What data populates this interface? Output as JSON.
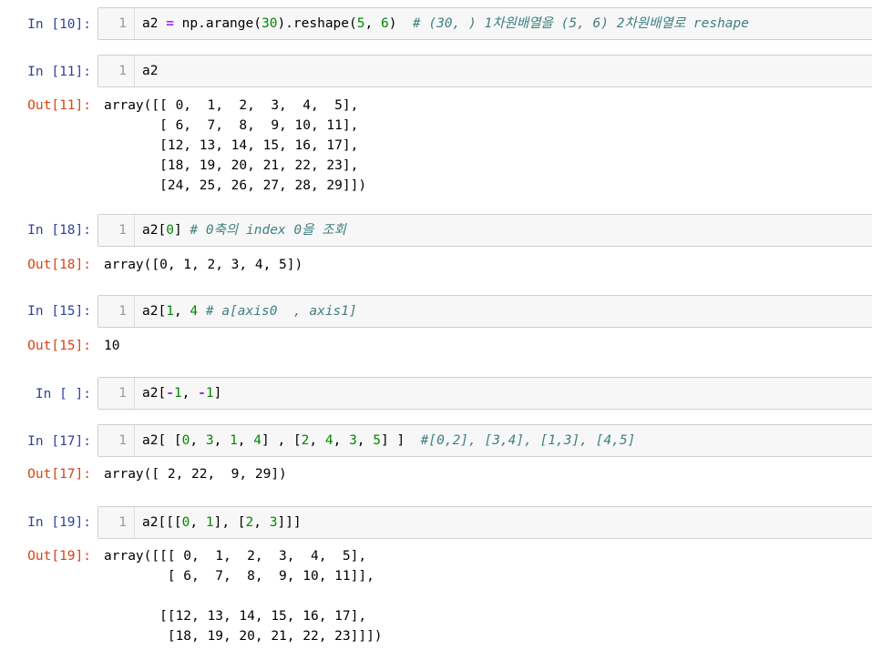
{
  "cells": [
    {
      "id": "c10",
      "prompt": "In [10]:",
      "line": "1",
      "tokens": [
        {
          "t": "a2 ",
          "k": "plain"
        },
        {
          "t": "=",
          "k": "op"
        },
        {
          "t": " np.arange(",
          "k": "plain"
        },
        {
          "t": "30",
          "k": "num"
        },
        {
          "t": ").reshape(",
          "k": "plain"
        },
        {
          "t": "5",
          "k": "num"
        },
        {
          "t": ", ",
          "k": "plain"
        },
        {
          "t": "6",
          "k": "num"
        },
        {
          "t": ")  ",
          "k": "plain"
        },
        {
          "t": "# (30, ) 1차원배열을 (5, 6) 2차원배열로 reshape",
          "k": "cmt"
        }
      ]
    },
    {
      "id": "c11",
      "prompt": "In [11]:",
      "line": "1",
      "tokens": [
        {
          "t": "a2",
          "k": "plain"
        }
      ],
      "out_prompt": "Out[11]:",
      "output": "array([[ 0,  1,  2,  3,  4,  5],\n       [ 6,  7,  8,  9, 10, 11],\n       [12, 13, 14, 15, 16, 17],\n       [18, 19, 20, 21, 22, 23],\n       [24, 25, 26, 27, 28, 29]])"
    },
    {
      "id": "c18",
      "prompt": "In [18]:",
      "line": "1",
      "tokens": [
        {
          "t": "a2[",
          "k": "plain"
        },
        {
          "t": "0",
          "k": "num"
        },
        {
          "t": "] ",
          "k": "plain"
        },
        {
          "t": "# 0축의 index 0을 조회",
          "k": "cmt"
        }
      ],
      "out_prompt": "Out[18]:",
      "output": "array([0, 1, 2, 3, 4, 5])"
    },
    {
      "id": "c15",
      "prompt": "In [15]:",
      "line": "1",
      "tokens": [
        {
          "t": "a2[",
          "k": "plain"
        },
        {
          "t": "1",
          "k": "num"
        },
        {
          "t": ", ",
          "k": "plain"
        },
        {
          "t": "4",
          "k": "num"
        },
        {
          "t": " ",
          "k": "plain"
        },
        {
          "t": "# a[axis0  , axis1]",
          "k": "cmt"
        }
      ],
      "out_prompt": "Out[15]:",
      "output": "10"
    },
    {
      "id": "cblank",
      "prompt": "In [ ]:",
      "line": "1",
      "tokens": [
        {
          "t": "a2[",
          "k": "plain"
        },
        {
          "t": "-",
          "k": "op"
        },
        {
          "t": "1",
          "k": "num"
        },
        {
          "t": ", ",
          "k": "plain"
        },
        {
          "t": "-",
          "k": "op"
        },
        {
          "t": "1",
          "k": "num"
        },
        {
          "t": "]",
          "k": "plain"
        }
      ]
    },
    {
      "id": "c17",
      "prompt": "In [17]:",
      "line": "1",
      "tokens": [
        {
          "t": "a2[ [",
          "k": "plain"
        },
        {
          "t": "0",
          "k": "num"
        },
        {
          "t": ", ",
          "k": "plain"
        },
        {
          "t": "3",
          "k": "num"
        },
        {
          "t": ", ",
          "k": "plain"
        },
        {
          "t": "1",
          "k": "num"
        },
        {
          "t": ", ",
          "k": "plain"
        },
        {
          "t": "4",
          "k": "num"
        },
        {
          "t": "] , [",
          "k": "plain"
        },
        {
          "t": "2",
          "k": "num"
        },
        {
          "t": ", ",
          "k": "plain"
        },
        {
          "t": "4",
          "k": "num"
        },
        {
          "t": ", ",
          "k": "plain"
        },
        {
          "t": "3",
          "k": "num"
        },
        {
          "t": ", ",
          "k": "plain"
        },
        {
          "t": "5",
          "k": "num"
        },
        {
          "t": "] ]  ",
          "k": "plain"
        },
        {
          "t": "#[0,2], [3,4], [1,3], [4,5]",
          "k": "cmt"
        }
      ],
      "out_prompt": "Out[17]:",
      "output": "array([ 2, 22,  9, 29])"
    },
    {
      "id": "c19",
      "prompt": "In [19]:",
      "line": "1",
      "tokens": [
        {
          "t": "a2[[[",
          "k": "plain"
        },
        {
          "t": "0",
          "k": "num"
        },
        {
          "t": ", ",
          "k": "plain"
        },
        {
          "t": "1",
          "k": "num"
        },
        {
          "t": "], [",
          "k": "plain"
        },
        {
          "t": "2",
          "k": "num"
        },
        {
          "t": ", ",
          "k": "plain"
        },
        {
          "t": "3",
          "k": "num"
        },
        {
          "t": "]]]",
          "k": "plain"
        }
      ],
      "out_prompt": "Out[19]:",
      "output": "array([[[ 0,  1,  2,  3,  4,  5],\n        [ 6,  7,  8,  9, 10, 11]],\n\n       [[12, 13, 14, 15, 16, 17],\n        [18, 19, 20, 21, 22, 23]]])"
    }
  ]
}
